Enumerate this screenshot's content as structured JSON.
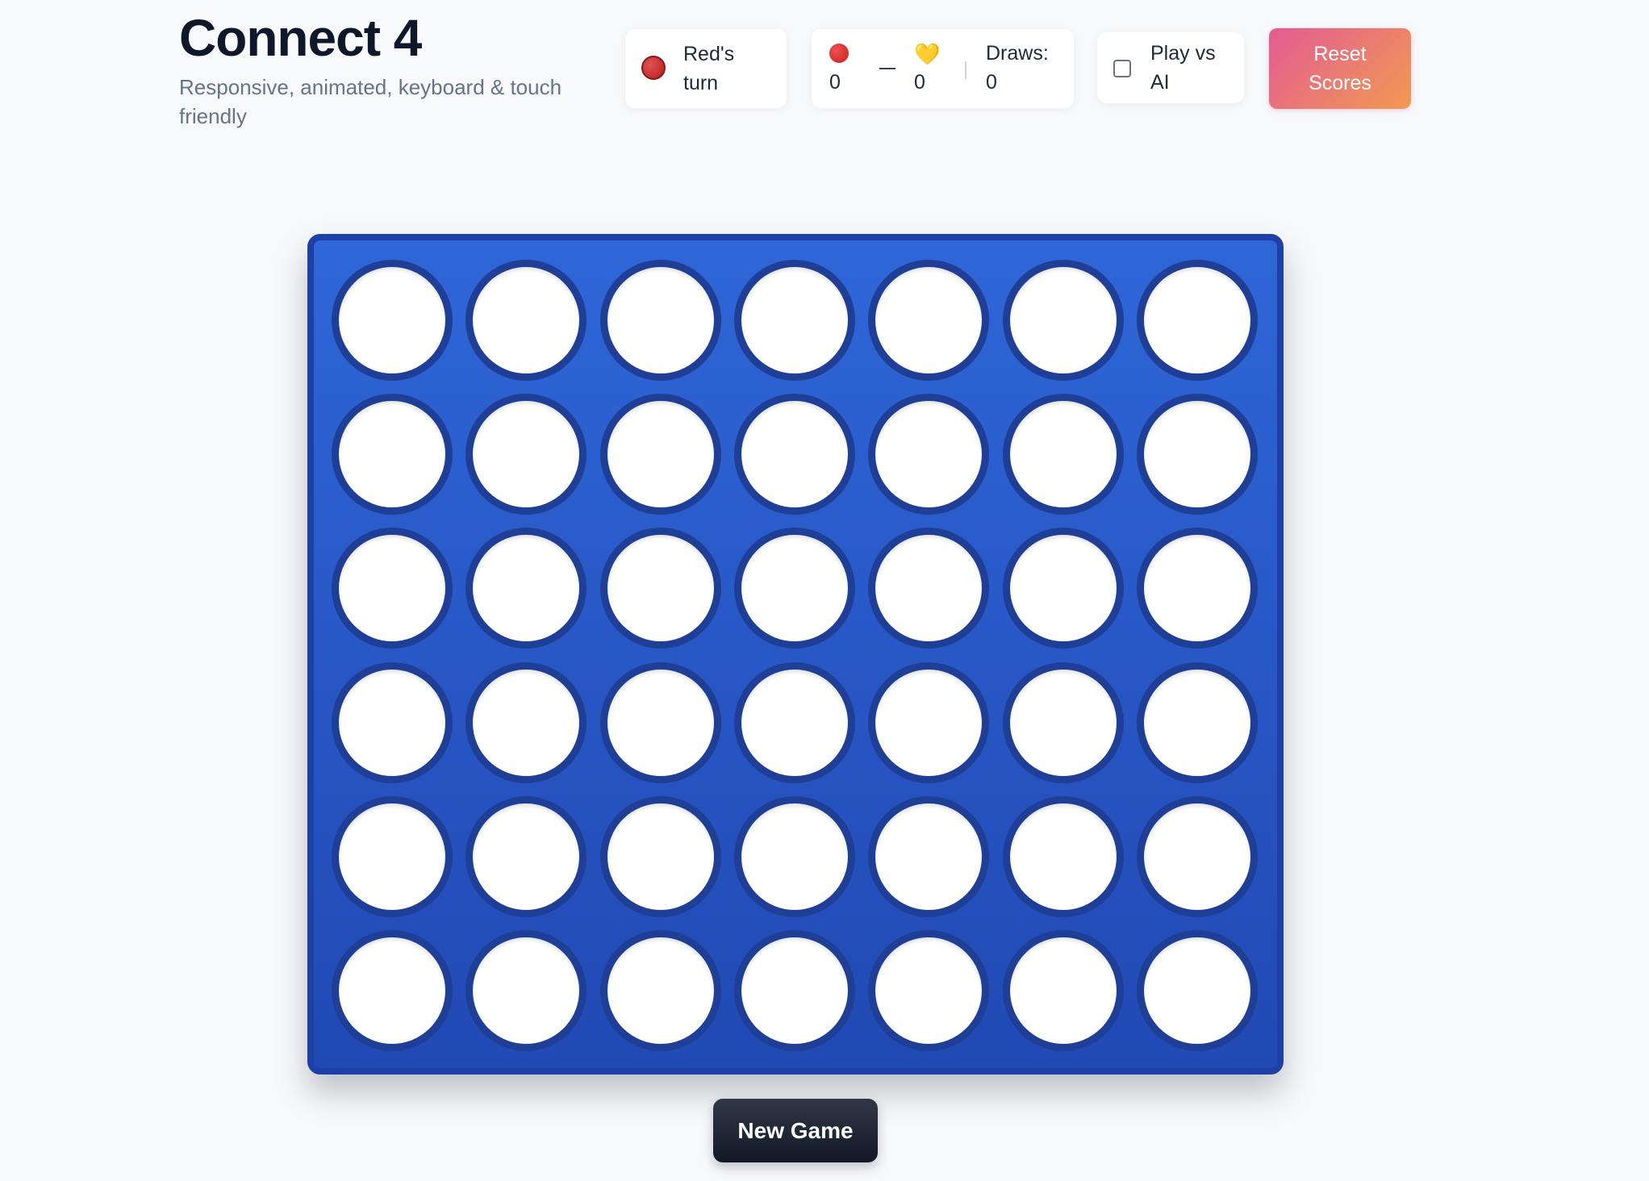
{
  "header": {
    "title": "Connect 4",
    "subtitle": "Responsive, animated, keyboard & touch friendly"
  },
  "status": {
    "turn_label": "Red's turn",
    "current_player": "red"
  },
  "scoreboard": {
    "red_icon": "red-disc-icon",
    "red_score": "0",
    "separator": "—",
    "yellow_icon": "yellow-heart-icon",
    "yellow_glyph": "💛",
    "yellow_score": "0",
    "draws_label": "Draws:",
    "draws_value": "0"
  },
  "ai_toggle": {
    "label": "Play vs AI",
    "checked": false
  },
  "buttons": {
    "reset_label": "Reset Scores",
    "new_game_label": "New Game"
  },
  "board": {
    "columns": 7,
    "rows": 6,
    "cells": [
      [
        "empty",
        "empty",
        "empty",
        "empty",
        "empty",
        "empty",
        "empty"
      ],
      [
        "empty",
        "empty",
        "empty",
        "empty",
        "empty",
        "empty",
        "empty"
      ],
      [
        "empty",
        "empty",
        "empty",
        "empty",
        "empty",
        "empty",
        "empty"
      ],
      [
        "empty",
        "empty",
        "empty",
        "empty",
        "empty",
        "empty",
        "empty"
      ],
      [
        "empty",
        "empty",
        "empty",
        "empty",
        "empty",
        "empty",
        "empty"
      ],
      [
        "empty",
        "empty",
        "empty",
        "empty",
        "empty",
        "empty",
        "empty"
      ]
    ]
  },
  "colors": {
    "board": "#2f66d8",
    "board_border": "#1e40a6",
    "red_disc": "#c81e1e",
    "yellow_disc": "#f5c542",
    "reset_gradient_start": "#e25b94",
    "reset_gradient_end": "#f29a52",
    "new_game_bg": "#111827"
  }
}
